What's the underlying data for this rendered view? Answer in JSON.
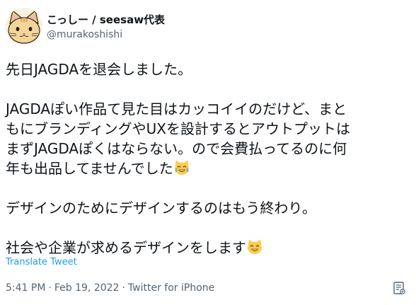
{
  "user": {
    "display_name": "こっしー / seesaw代表",
    "handle": "@murakoshishi",
    "avatar_icon": "cat-face-icon"
  },
  "tweet": {
    "lines": [
      "先日JAGDAを退会しました。",
      "JAGDAぽい作品て見た目はカッコイイのだけど、まと",
      "もにブランディングやUXを設計するとアウトプットは",
      "まずJAGDAぽくはならない。ので会費払ってるのに何",
      "年も出品してませんでした",
      "デザインのためにデザインするのはもう終わり。",
      "社会や企業が求めるデザインをします"
    ],
    "emoji_1": "grinning-cat-with-tears-icon",
    "emoji_2": "grinning-cat-icon"
  },
  "translate_label": "Translate Tweet",
  "meta": {
    "time": "5:41 PM",
    "date": "Feb 19, 2022",
    "source": "Twitter for iPhone",
    "separator": "·"
  },
  "colors": {
    "text": "#0f1419",
    "secondary": "#536471",
    "link": "#1d9bf0"
  }
}
